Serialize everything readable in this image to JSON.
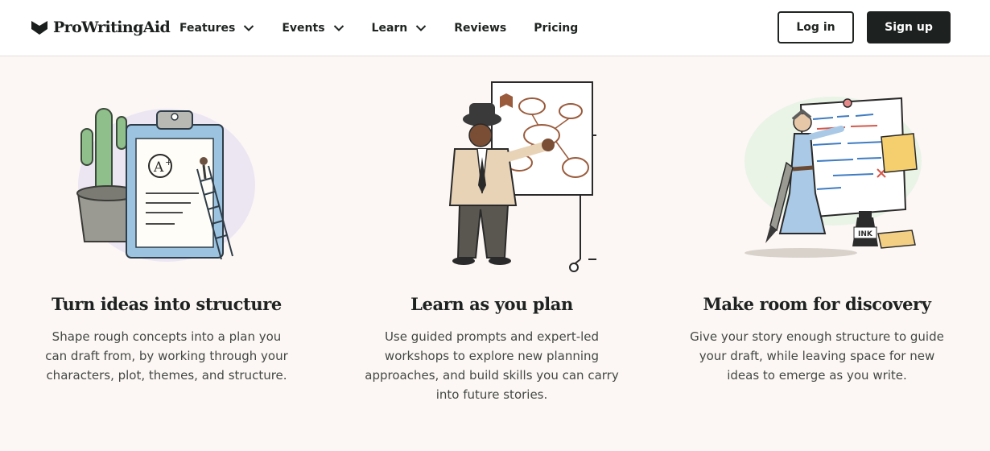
{
  "header": {
    "logo_text": "ProWritingAid",
    "nav": [
      {
        "label": "Features",
        "dropdown": true
      },
      {
        "label": "Events",
        "dropdown": true
      },
      {
        "label": "Learn",
        "dropdown": true
      },
      {
        "label": "Reviews",
        "dropdown": false
      },
      {
        "label": "Pricing",
        "dropdown": false
      }
    ],
    "login_label": "Log in",
    "signup_label": "Sign up"
  },
  "features": [
    {
      "title": "Turn ideas into structure",
      "description_lines": [
        "Shape rough concepts into a plan you",
        "can draft from, by working through your",
        "characters, plot, themes, and structure."
      ],
      "illustration": "clipboard-cactus-illustration"
    },
    {
      "title": "Learn as you plan",
      "description_lines": [
        "Use guided prompts and expert-led",
        "workshops to explore new planning",
        "approaches, and build skills you can carry",
        "into future stories."
      ],
      "illustration": "whiteboard-teacher-illustration"
    },
    {
      "title": "Make room for discovery",
      "description_lines": [
        "Give your story enough structure to guide",
        "your draft, while leaving space for new",
        "ideas to emerge as you write."
      ],
      "illustration": "pen-sword-writer-illustration",
      "ink_label": "INK"
    }
  ],
  "colors": {
    "background": "#fcf7f4",
    "header_bg": "#ffffff",
    "primary_dark": "#1d2220",
    "text_body": "#434845"
  }
}
